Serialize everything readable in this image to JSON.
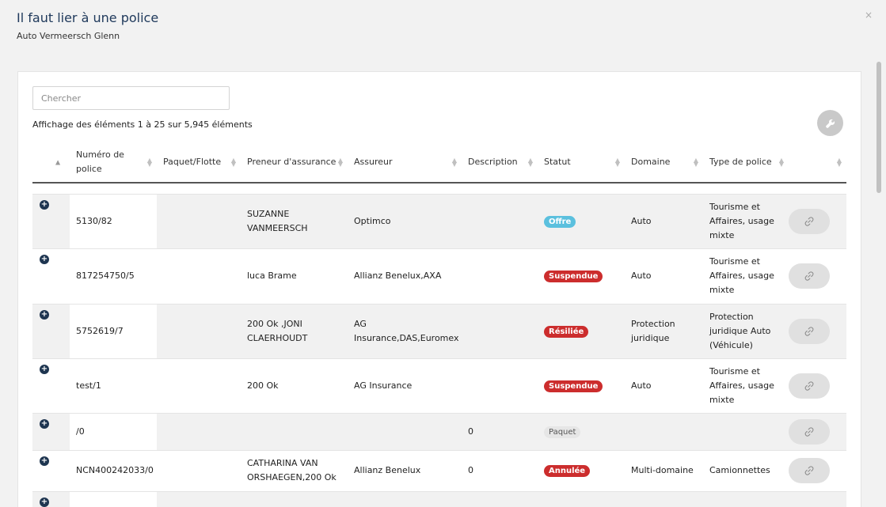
{
  "header": {
    "title": "Il faut lier à une police",
    "subtitle": "Auto Vermeersch Glenn",
    "close": "×"
  },
  "search": {
    "placeholder": "Chercher"
  },
  "info": "Affichage des éléments 1 à 25 sur 5,945 éléments",
  "columns": {
    "numero": "Numéro de police",
    "paquet": "Paquet/Flotte",
    "preneur": "Preneur d'assurance",
    "assureur": "Assureur",
    "description": "Description",
    "statut": "Statut",
    "domaine": "Domaine",
    "type": "Type de police"
  },
  "rows": [
    {
      "numero": "5130/82",
      "paquet": "",
      "preneur": "SUZANNE VANMEERSCH",
      "assureur": "Optimco",
      "description": "",
      "statut": "Offre",
      "domaine": "Auto",
      "type": "Tourisme et Affaires, usage mixte"
    },
    {
      "numero": "817254750/5",
      "paquet": "",
      "preneur": "luca Brame",
      "assureur": "Allianz Benelux,AXA",
      "description": "",
      "statut": "Suspendue",
      "domaine": "Auto",
      "type": "Tourisme et Affaires, usage mixte"
    },
    {
      "numero": "5752619/7",
      "paquet": "",
      "preneur": "200 Ok ,JONI CLAERHOUDT",
      "assureur": "AG Insurance,DAS,Euromex",
      "description": "",
      "statut": "Résiliée",
      "domaine": "Protection juridique",
      "type": "Protection juridique Auto (Véhicule)"
    },
    {
      "numero": "test/1",
      "paquet": "",
      "preneur": "200 Ok",
      "assureur": "AG Insurance",
      "description": "",
      "statut": "Suspendue",
      "domaine": "Auto",
      "type": "Tourisme et Affaires, usage mixte"
    },
    {
      "numero": "/0",
      "paquet": "",
      "preneur": "",
      "assureur": "",
      "description": "0",
      "statut": "Paquet",
      "domaine": "",
      "type": ""
    },
    {
      "numero": "NCN400242033/0",
      "paquet": "",
      "preneur": "CATHARINA VAN ORSHAEGEN,200 Ok",
      "assureur": "Allianz Benelux",
      "description": "0",
      "statut": "Annulée",
      "domaine": "Multi-domaine",
      "type": "Camionnettes"
    }
  ],
  "colors": {
    "offre": "#5bc0de",
    "danger": "#cc2d2d",
    "navy": "#1e3550",
    "title": "#203a5c"
  },
  "icons": [
    "close-icon",
    "wrench-icon",
    "sort-icon",
    "expand-plus-icon",
    "link-icon"
  ]
}
